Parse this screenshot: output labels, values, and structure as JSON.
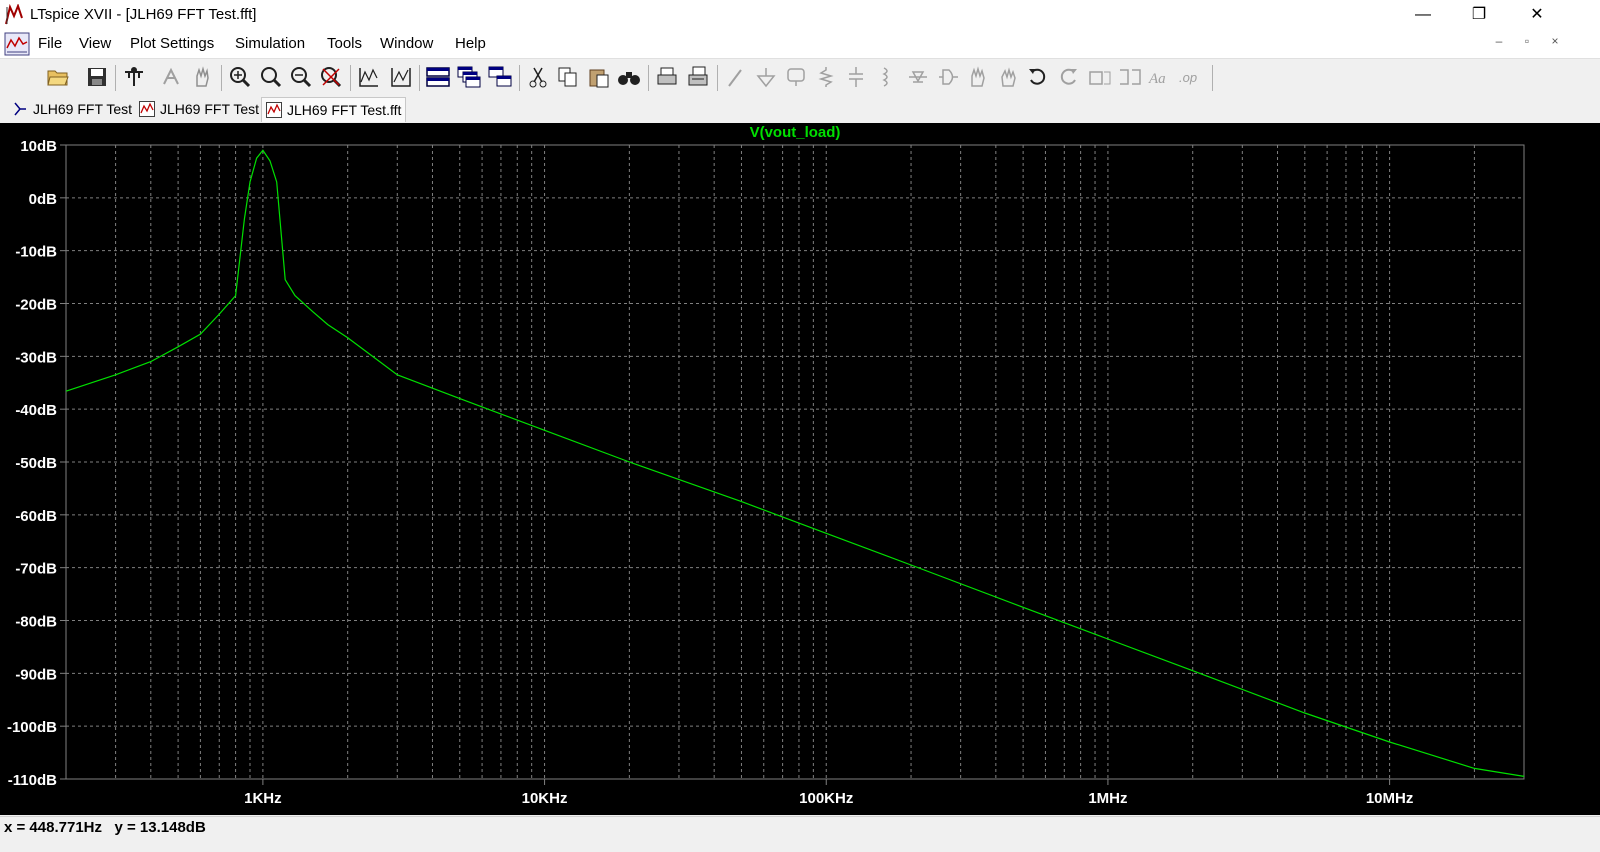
{
  "window": {
    "title": "LTspice XVII - [JLH69 FFT Test.fft]",
    "controls": [
      "—",
      "❐",
      "✕"
    ]
  },
  "menu": {
    "items": [
      "File",
      "View",
      "Plot Settings",
      "Simulation",
      "Tools",
      "Window",
      "Help"
    ],
    "mdi_controls": [
      "–",
      "▫",
      "×"
    ]
  },
  "toolbar": {
    "buttons": [
      "open-icon",
      "save-icon",
      "control-panel-icon",
      "run-icon",
      "pan-icon",
      "zoom-in-icon",
      "zoom-full-icon",
      "zoom-out-icon",
      "zoom-cancel-icon",
      "autorange-icon",
      "manual-limits-icon",
      "tile-horizontal-icon",
      "cascade-icon",
      "tile-vertical-icon",
      "cut-icon",
      "copy-icon",
      "paste-icon",
      "find-icon",
      "print-icon",
      "print-setup-icon",
      "wire-icon",
      "ground-icon",
      "label-icon",
      "resistor-icon",
      "capacitor-icon",
      "inductor-icon",
      "diode-icon",
      "component-icon",
      "move-icon",
      "drag-icon",
      "undo-icon",
      "redo-icon",
      "rotate-icon",
      "mirror-icon",
      "text-icon",
      "spice-directive-icon"
    ]
  },
  "tabs": [
    {
      "label": "JLH69 FFT Test",
      "icon": "schematic-icon",
      "active": false
    },
    {
      "label": "JLH69 FFT Test",
      "icon": "waveform-icon",
      "active": false
    },
    {
      "label": "JLH69 FFT Test.fft",
      "icon": "waveform-icon",
      "active": true
    }
  ],
  "status": {
    "text": "x = 448.771Hz   y = 13.148dB"
  },
  "colors": {
    "trace": "#00e000",
    "grid": "#808080",
    "background": "#000000",
    "axis_text": "#ffffff"
  },
  "chart_data": {
    "type": "line",
    "title": "V(vout_load)",
    "xlabel": "",
    "ylabel": "",
    "x_scale": "log",
    "x_range": [
      200,
      30000000
    ],
    "y_range": [
      -110,
      10
    ],
    "x_tick_values": [
      1000,
      10000,
      100000,
      1000000,
      10000000
    ],
    "x_tick_labels": [
      "1KHz",
      "10KHz",
      "100KHz",
      "1MHz",
      "10MHz"
    ],
    "y_tick_values": [
      10,
      0,
      -10,
      -20,
      -30,
      -40,
      -50,
      -60,
      -70,
      -80,
      -90,
      -100,
      -110
    ],
    "y_tick_labels": [
      "10dB",
      "0dB",
      "-10dB",
      "-20dB",
      "-30dB",
      "-40dB",
      "-50dB",
      "-60dB",
      "-70dB",
      "-80dB",
      "-90dB",
      "-100dB",
      "-110dB"
    ],
    "grid": true,
    "series": [
      {
        "name": "V(vout_load)",
        "x": [
          200,
          300,
          400,
          500,
          600,
          700,
          800,
          860,
          900,
          950,
          1000,
          1060,
          1120,
          1200,
          1300,
          1500,
          1700,
          2000,
          3000,
          5000,
          10000,
          20000,
          50000,
          100000,
          200000,
          500000,
          1000000,
          2000000,
          5000000,
          10000000,
          20000000,
          30000000
        ],
        "y": [
          -36.6,
          -33.5,
          -31.0,
          -28.2,
          -25.8,
          -22.0,
          -18.5,
          -4.0,
          3.0,
          7.5,
          9.0,
          7.0,
          3.0,
          -15.5,
          -18.5,
          -21.5,
          -24.0,
          -26.5,
          -33.5,
          -38.0,
          -44.0,
          -50.0,
          -57.5,
          -63.5,
          -69.5,
          -77.5,
          -83.5,
          -89.5,
          -97.5,
          -103.0,
          -108.0,
          -109.5
        ]
      }
    ]
  }
}
